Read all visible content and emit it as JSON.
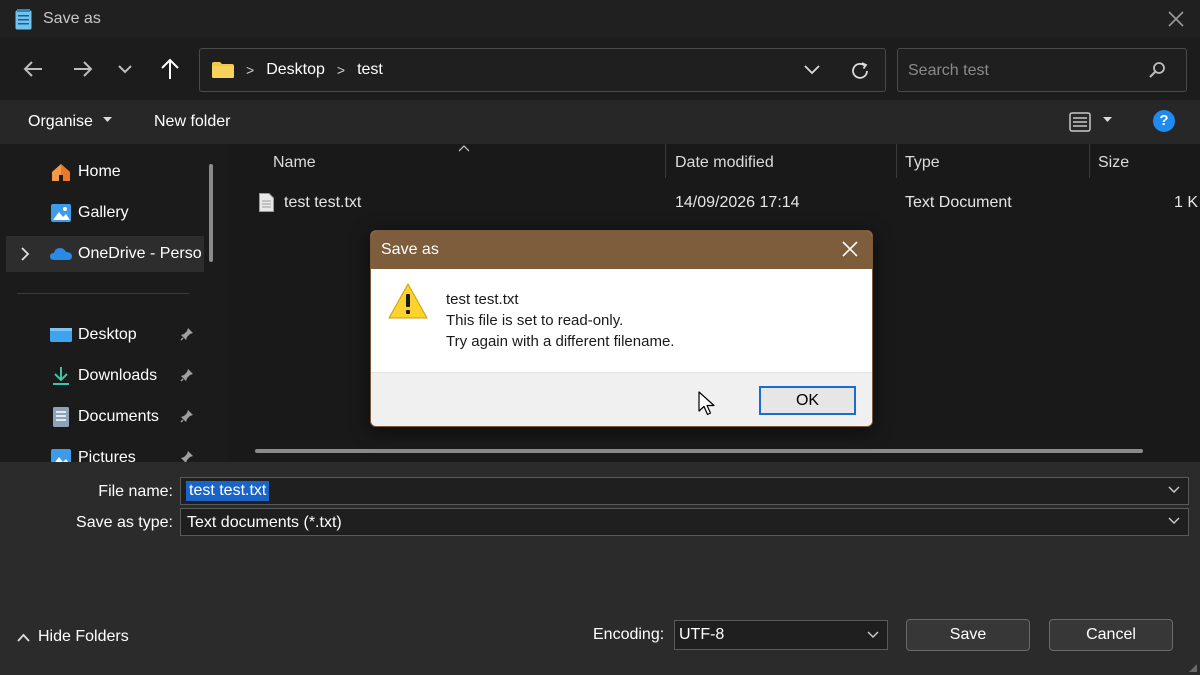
{
  "window": {
    "title": "Save as"
  },
  "address": {
    "crumbs": [
      "Desktop",
      "test"
    ]
  },
  "search": {
    "placeholder": "Search test"
  },
  "toolbar": {
    "organise": "Organise",
    "new_folder": "New folder",
    "help": "?"
  },
  "sidebar": {
    "top_items": [
      {
        "label": "Home",
        "icon": "home-icon"
      },
      {
        "label": "Gallery",
        "icon": "gallery-icon"
      },
      {
        "label": "OneDrive - Perso",
        "icon": "onedrive-icon"
      }
    ],
    "quick_items": [
      {
        "label": "Desktop",
        "icon": "desktop-icon"
      },
      {
        "label": "Downloads",
        "icon": "download-icon"
      },
      {
        "label": "Documents",
        "icon": "documents-icon"
      },
      {
        "label": "Pictures",
        "icon": "pictures-icon"
      }
    ]
  },
  "columns": {
    "name": "Name",
    "date": "Date modified",
    "type": "Type",
    "size": "Size"
  },
  "files": [
    {
      "name": "test test.txt",
      "date": "14/09/2026 17:14",
      "type": "Text Document",
      "size": "1 K"
    }
  ],
  "form": {
    "file_name_label": "File name:",
    "file_name_value": "test test.txt",
    "type_label": "Save as type:",
    "type_value": "Text documents (*.txt)",
    "encoding_label": "Encoding:",
    "encoding_value": "UTF-8",
    "save": "Save",
    "cancel": "Cancel",
    "hide_folders": "Hide Folders"
  },
  "dialog": {
    "title": "Save as",
    "filename": "test test.txt",
    "line1": "This file is set to read-only.",
    "line2": "Try again with a different filename.",
    "ok": "OK"
  },
  "colors": {
    "accent": "#1f8bf0",
    "dialog_titlebar": "#7e5d3c",
    "selection": "#1a64c8"
  }
}
